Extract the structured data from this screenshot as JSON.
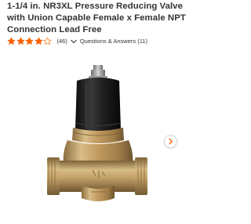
{
  "product": {
    "title": "1-1/4 in. NR3XL Pressure Reducing Valve with Union Capable Female x Female NPT Connection Lead Free",
    "rating": 4,
    "rating_max": 5,
    "review_count": "(46)",
    "qa_label": "Questions & Answers (11)"
  },
  "icons": {
    "star": "star-icon",
    "expand": "chevron-down-icon",
    "next": "chevron-right-icon"
  },
  "colors": {
    "star_fill": "#f96302",
    "text": "#333333",
    "brass": "#c8a36b",
    "valve_cap": "#202020"
  }
}
